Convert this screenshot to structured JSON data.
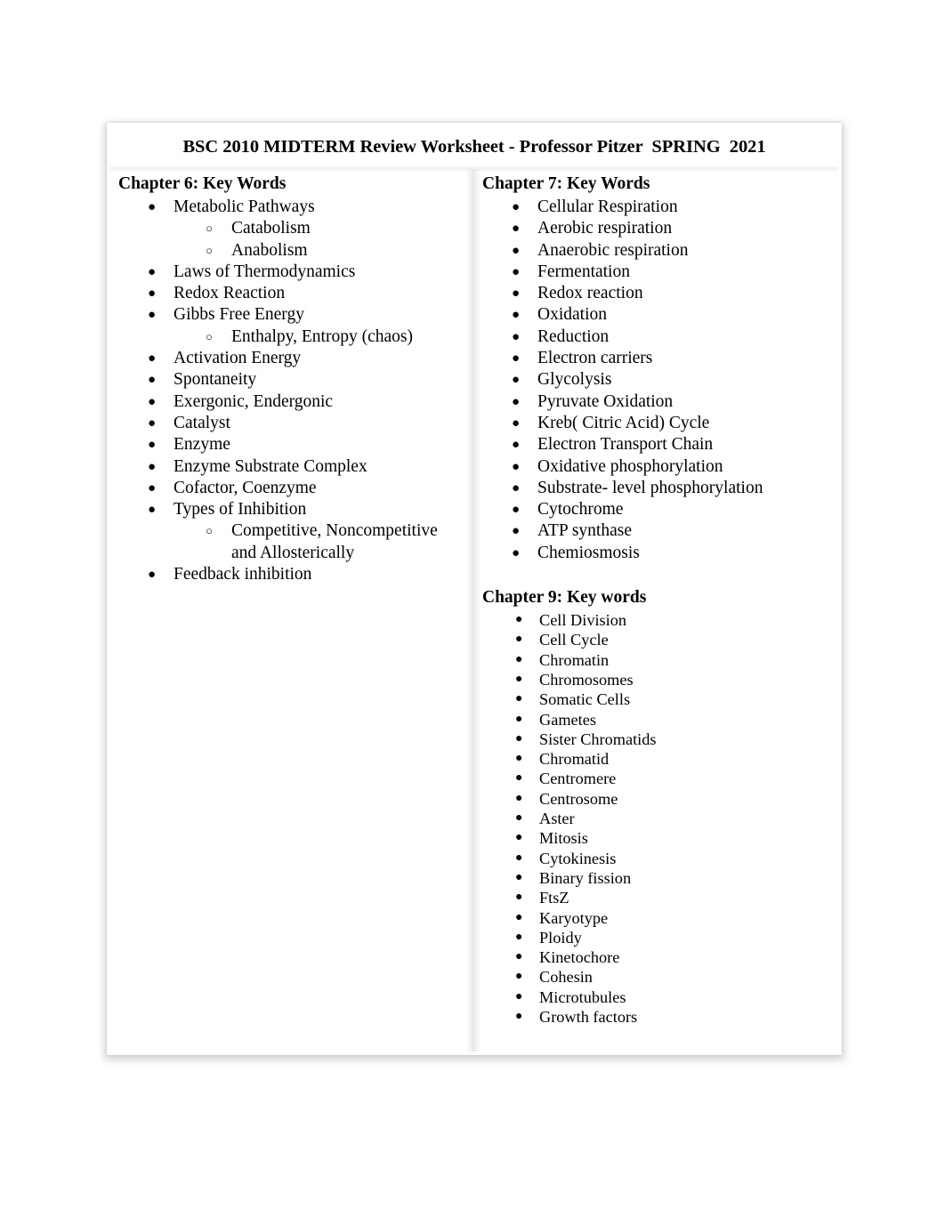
{
  "document": {
    "title": "BSC 2010 MIDTERM Review Worksheet - Professor Pitzer  SPRING  2021",
    "background_color": "#ffffff",
    "page_color": "#ffffff",
    "text_color": "#000000"
  },
  "columns": {
    "left": {
      "sections": [
        {
          "heading": "Chapter 6: Key Words",
          "items": [
            {
              "level": 1,
              "text": "Metabolic Pathways"
            },
            {
              "level": 2,
              "text": "Catabolism"
            },
            {
              "level": 2,
              "text": "Anabolism"
            },
            {
              "level": 1,
              "text": "Laws of Thermodynamics"
            },
            {
              "level": 1,
              "text": "Redox Reaction"
            },
            {
              "level": 1,
              "text": "Gibbs Free Energy"
            },
            {
              "level": 2,
              "text": "Enthalpy, Entropy (chaos)"
            },
            {
              "level": 1,
              "text": "Activation Energy"
            },
            {
              "level": 1,
              "text": "Spontaneity"
            },
            {
              "level": 1,
              "text": "Exergonic, Endergonic"
            },
            {
              "level": 1,
              "text": "Catalyst"
            },
            {
              "level": 1,
              "text": "Enzyme"
            },
            {
              "level": 1,
              "text": "Enzyme Substrate Complex"
            },
            {
              "level": 1,
              "text": "Cofactor, Coenzyme"
            },
            {
              "level": 1,
              "text": "Types of Inhibition"
            },
            {
              "level": 2,
              "text": "Competitive, Noncompetitive and Allosterically"
            },
            {
              "level": 1,
              "text": "Feedback inhibition"
            }
          ]
        }
      ]
    },
    "right": {
      "sections": [
        {
          "heading": "Chapter 7: Key Words",
          "compact": false,
          "items": [
            {
              "level": 1,
              "text": "Cellular Respiration"
            },
            {
              "level": 1,
              "text": "Aerobic respiration"
            },
            {
              "level": 1,
              "text": "Anaerobic respiration"
            },
            {
              "level": 1,
              "text": "Fermentation"
            },
            {
              "level": 1,
              "text": "Redox reaction"
            },
            {
              "level": 1,
              "text": "Oxidation"
            },
            {
              "level": 1,
              "text": "Reduction"
            },
            {
              "level": 1,
              "text": "Electron carriers"
            },
            {
              "level": 1,
              "text": "Glycolysis"
            },
            {
              "level": 1,
              "text": "Pyruvate Oxidation"
            },
            {
              "level": 1,
              "text": "Kreb( Citric Acid) Cycle"
            },
            {
              "level": 1,
              "text": "Electron Transport Chain"
            },
            {
              "level": 1,
              "text": "Oxidative phosphorylation"
            },
            {
              "level": 1,
              "text": "Substrate- level phosphorylation"
            },
            {
              "level": 1,
              "text": "Cytochrome"
            },
            {
              "level": 1,
              "text": "ATP synthase"
            },
            {
              "level": 1,
              "text": "Chemiosmosis"
            }
          ]
        },
        {
          "heading": "Chapter 9: Key words",
          "compact": true,
          "items": [
            {
              "level": 1,
              "text": "Cell Division"
            },
            {
              "level": 1,
              "text": "Cell Cycle"
            },
            {
              "level": 1,
              "text": "Chromatin"
            },
            {
              "level": 1,
              "text": "Chromosomes"
            },
            {
              "level": 1,
              "text": "Somatic Cells"
            },
            {
              "level": 1,
              "text": "Gametes"
            },
            {
              "level": 1,
              "text": "Sister Chromatids"
            },
            {
              "level": 1,
              "text": "Chromatid"
            },
            {
              "level": 1,
              "text": "Centromere"
            },
            {
              "level": 1,
              "text": "Centrosome"
            },
            {
              "level": 1,
              "text": "Aster"
            },
            {
              "level": 1,
              "text": "Mitosis"
            },
            {
              "level": 1,
              "text": "Cytokinesis"
            },
            {
              "level": 1,
              "text": "Binary fission"
            },
            {
              "level": 1,
              "text": "FtsZ"
            },
            {
              "level": 1,
              "text": "Karyotype"
            },
            {
              "level": 1,
              "text": "Ploidy"
            },
            {
              "level": 1,
              "text": "Kinetochore"
            },
            {
              "level": 1,
              "text": "Cohesin"
            },
            {
              "level": 1,
              "text": "Microtubules"
            },
            {
              "level": 1,
              "text": "Growth factors"
            }
          ]
        }
      ]
    }
  },
  "bullets": {
    "level1_glyph": "●",
    "level2_glyph": "○"
  }
}
